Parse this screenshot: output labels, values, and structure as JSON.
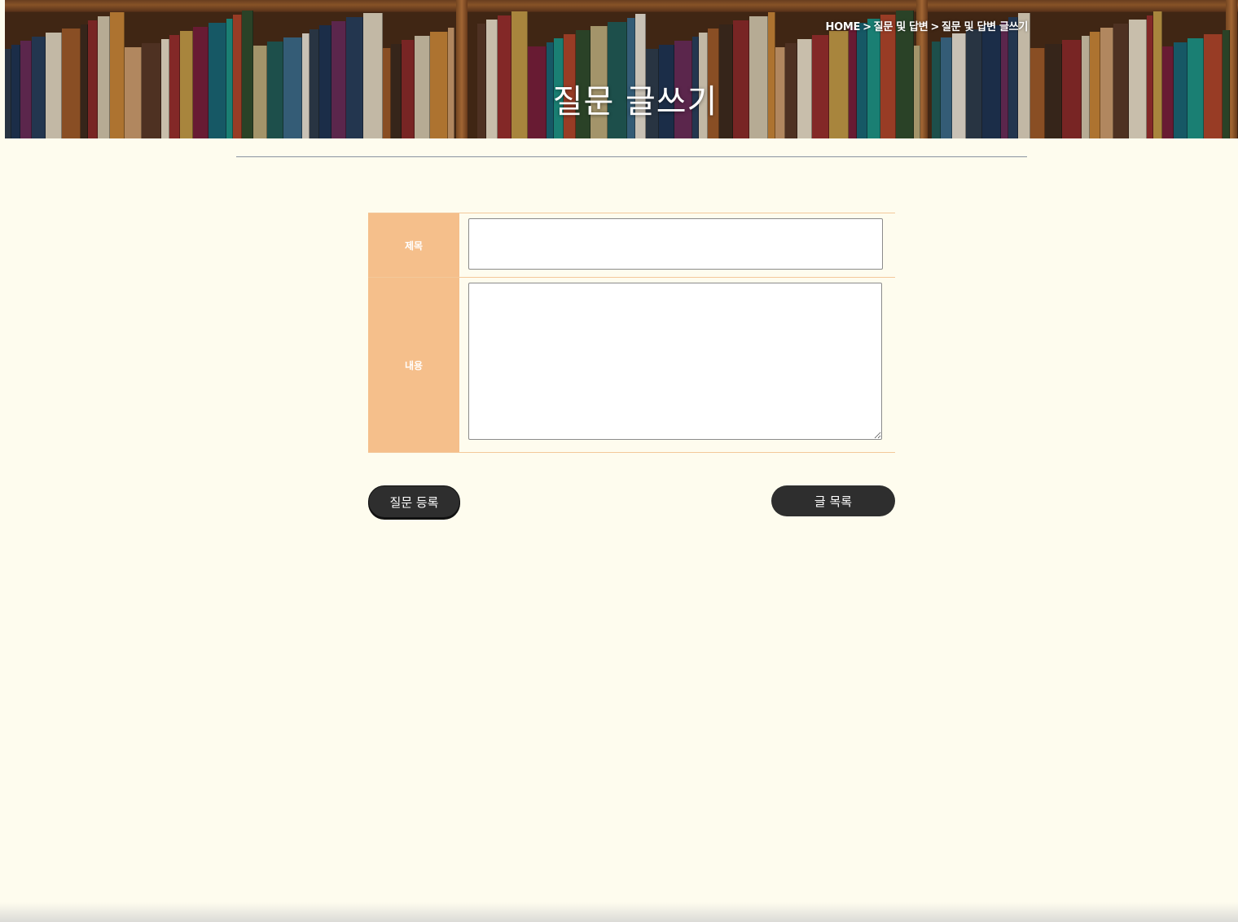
{
  "banner": {
    "breadcrumb": {
      "home": "HOME",
      "separator": ">",
      "section": "질문 및 답변",
      "current": "질문 및 답변 글쓰기"
    },
    "title": "질문 글쓰기"
  },
  "form": {
    "title_label": "제목",
    "title_value": "",
    "title_placeholder": "",
    "content_label": "내용",
    "content_value": "",
    "content_placeholder": ""
  },
  "buttons": {
    "submit_label": "질문 등록",
    "list_label": "글 목록"
  },
  "colors": {
    "page_background": "#fefcee",
    "label_background": "#f5bf8b",
    "button_background": "#2e2e2e"
  }
}
